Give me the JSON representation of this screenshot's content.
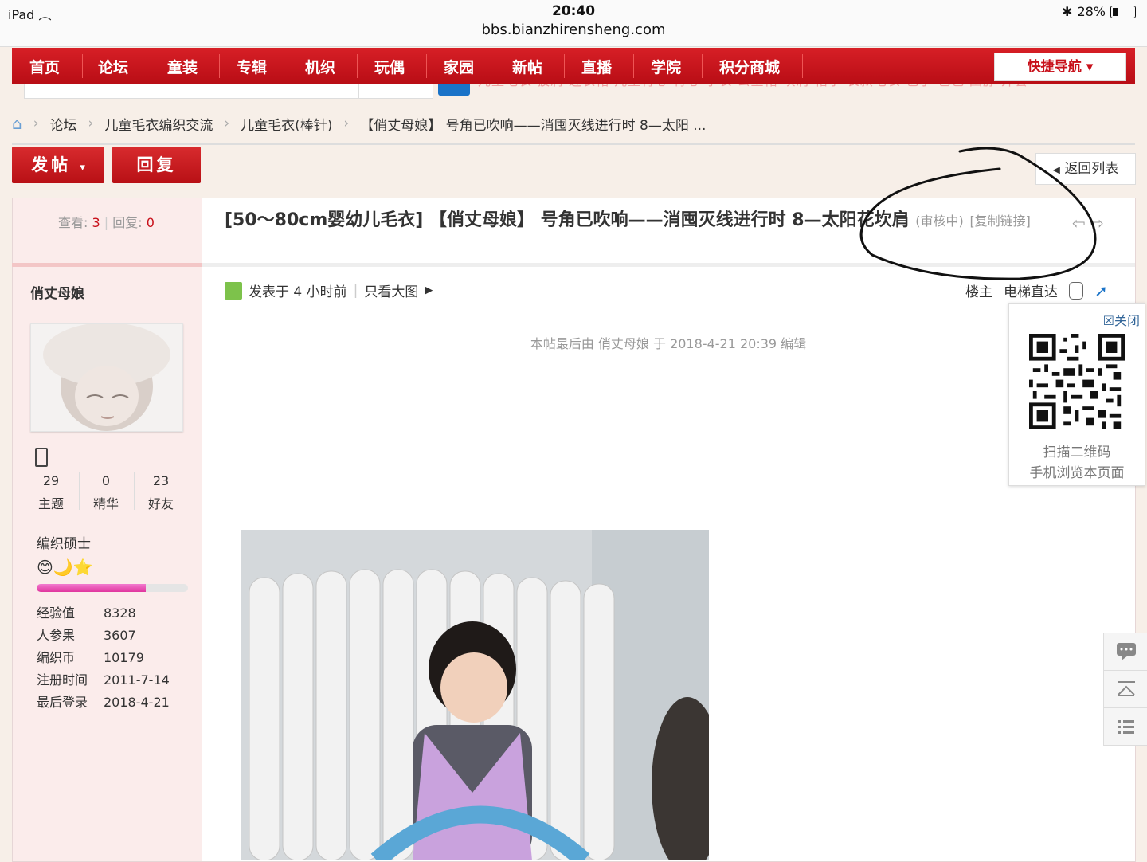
{
  "status_bar": {
    "device": "iPad",
    "time": "20:40",
    "url": "bbs.bianzhirensheng.com",
    "battery": "28%"
  },
  "nav": {
    "items": [
      "首页",
      "论坛",
      "童装",
      "专辑",
      "机织",
      "玩偶",
      "家园",
      "新帖",
      "直播",
      "学院",
      "积分商城"
    ],
    "quick_nav": "快捷导航",
    "hot_tags": "儿童毛衣  披肩  连衣裙  儿童背心  背心  小衣  公主裙  坎肩  帽子  长款毛衣  毯子  包包  围脖  外套",
    "accent": "#c8101a"
  },
  "breadcrumb": [
    "论坛",
    "儿童毛衣编织交流",
    "儿童毛衣(棒针)",
    "【俏丈母娘】 号角已吹响——消囤灭线进行时 8—太阳 ..."
  ],
  "actions": {
    "new_post": "发帖",
    "reply": "回复",
    "back_to_list": "返回列表"
  },
  "thread_stats": {
    "views_label": "查看:",
    "views": "3",
    "replies_label": "回复:",
    "replies": "0"
  },
  "author": {
    "name": "俏丈母娘",
    "counts": [
      {
        "value": "29",
        "label": "主题"
      },
      {
        "value": "0",
        "label": "精华"
      },
      {
        "value": "23",
        "label": "好友"
      }
    ],
    "rank": "编织硕士",
    "rank_icons": "😊🌙⭐",
    "progress": 0.72,
    "info": [
      {
        "k": "经验值",
        "v": "8328"
      },
      {
        "k": "人参果",
        "v": "3607"
      },
      {
        "k": "编织币",
        "v": "10179"
      },
      {
        "k": "注册时间",
        "v": "2011-7-14"
      },
      {
        "k": "最后登录",
        "v": "2018-4-21"
      }
    ]
  },
  "post": {
    "title": "[50～80cm婴幼儿毛衣] 【俏丈母娘】 号角已吹响——消囤灭线进行时 8—太阳花坎肩",
    "status": "(审核中)",
    "copy_link": "[复制链接]",
    "posted": "发表于 4 小时前",
    "view_big": "只看大图",
    "floor": "楼主",
    "elevator": "电梯直达",
    "edit_note": "本帖最后由 俏丈母娘 于 2018-4-21 20:39 编辑"
  },
  "qr_popup": {
    "close": "关闭",
    "line1": "扫描二维码",
    "line2": "手机浏览本页面"
  }
}
